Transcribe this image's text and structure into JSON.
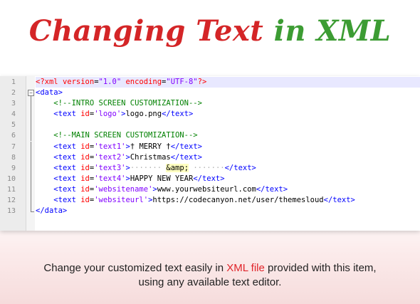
{
  "title": {
    "part1": "Changing Text",
    "part2": "in XML",
    "colors": {
      "part1": "#d42527",
      "part2": "#3c9c33"
    }
  },
  "editor": {
    "lines": [
      {
        "num": "1",
        "segments": [
          {
            "t": "<?xml ",
            "c": "pi"
          },
          {
            "t": "version",
            "c": "pi"
          },
          {
            "t": "=",
            "c": "txt"
          },
          {
            "t": "\"1.0\"",
            "c": "pival"
          },
          {
            "t": " encoding",
            "c": "pi"
          },
          {
            "t": "=",
            "c": "txt"
          },
          {
            "t": "\"UTF-8\"",
            "c": "pival"
          },
          {
            "t": "?>",
            "c": "pi"
          }
        ],
        "highlight": true
      },
      {
        "num": "2",
        "segments": [
          {
            "t": "<data>",
            "c": "tag"
          }
        ],
        "fold": "open"
      },
      {
        "num": "3",
        "segments": [
          {
            "t": "    ",
            "c": "txt"
          },
          {
            "t": "<!--INTRO SCREEN CUSTOMIZATION-->",
            "c": "comment"
          }
        ],
        "fold": "line"
      },
      {
        "num": "4",
        "segments": [
          {
            "t": "    ",
            "c": "txt"
          },
          {
            "t": "<text ",
            "c": "tag"
          },
          {
            "t": "id",
            "c": "attr"
          },
          {
            "t": "=",
            "c": "txt"
          },
          {
            "t": "'logo'",
            "c": "val"
          },
          {
            "t": ">",
            "c": "tag"
          },
          {
            "t": "logo.png",
            "c": "txt"
          },
          {
            "t": "</text>",
            "c": "tag"
          }
        ],
        "fold": "line"
      },
      {
        "num": "5",
        "segments": [],
        "fold": "line"
      },
      {
        "num": "6",
        "segments": [
          {
            "t": "    ",
            "c": "txt"
          },
          {
            "t": "<!--MAIN SCREEN CUSTOMIZATION-->",
            "c": "comment"
          }
        ],
        "fold": "line"
      },
      {
        "num": "7",
        "segments": [
          {
            "t": "    ",
            "c": "txt"
          },
          {
            "t": "<text ",
            "c": "tag"
          },
          {
            "t": "id",
            "c": "attr"
          },
          {
            "t": "=",
            "c": "txt"
          },
          {
            "t": "'text1'",
            "c": "val"
          },
          {
            "t": ">",
            "c": "tag"
          },
          {
            "t": "† MERRY †",
            "c": "txt"
          },
          {
            "t": "</text>",
            "c": "tag"
          }
        ],
        "fold": "line"
      },
      {
        "num": "8",
        "segments": [
          {
            "t": "    ",
            "c": "txt"
          },
          {
            "t": "<text ",
            "c": "tag"
          },
          {
            "t": "id",
            "c": "attr"
          },
          {
            "t": "=",
            "c": "txt"
          },
          {
            "t": "'text2'",
            "c": "val"
          },
          {
            "t": ">",
            "c": "tag"
          },
          {
            "t": "Christmas",
            "c": "txt"
          },
          {
            "t": "</text>",
            "c": "tag"
          }
        ],
        "fold": "line"
      },
      {
        "num": "9",
        "segments": [
          {
            "t": "    ",
            "c": "txt"
          },
          {
            "t": "<text ",
            "c": "tag"
          },
          {
            "t": "id",
            "c": "attr"
          },
          {
            "t": "=",
            "c": "txt"
          },
          {
            "t": "'text3'",
            "c": "val"
          },
          {
            "t": ">",
            "c": "tag"
          },
          {
            "t": "·······",
            "c": "dots"
          },
          {
            "t": " ",
            "c": "txt"
          },
          {
            "t": "&amp;",
            "c": "ent"
          },
          {
            "t": " ",
            "c": "txt"
          },
          {
            "t": "·······",
            "c": "dots"
          },
          {
            "t": "</text>",
            "c": "tag"
          }
        ],
        "fold": "line"
      },
      {
        "num": "10",
        "segments": [
          {
            "t": "    ",
            "c": "txt"
          },
          {
            "t": "<text ",
            "c": "tag"
          },
          {
            "t": "id",
            "c": "attr"
          },
          {
            "t": "=",
            "c": "txt"
          },
          {
            "t": "'text4'",
            "c": "val"
          },
          {
            "t": ">",
            "c": "tag"
          },
          {
            "t": "HAPPY NEW YEAR",
            "c": "txt"
          },
          {
            "t": "</text>",
            "c": "tag"
          }
        ],
        "fold": "line"
      },
      {
        "num": "11",
        "segments": [
          {
            "t": "    ",
            "c": "txt"
          },
          {
            "t": "<text ",
            "c": "tag"
          },
          {
            "t": "id",
            "c": "attr"
          },
          {
            "t": "=",
            "c": "txt"
          },
          {
            "t": "'websitename'",
            "c": "val"
          },
          {
            "t": ">",
            "c": "tag"
          },
          {
            "t": "www.yourwebsiteurl.com",
            "c": "txt"
          },
          {
            "t": "</text>",
            "c": "tag"
          }
        ],
        "fold": "line"
      },
      {
        "num": "12",
        "segments": [
          {
            "t": "    ",
            "c": "txt"
          },
          {
            "t": "<text ",
            "c": "tag"
          },
          {
            "t": "id",
            "c": "attr"
          },
          {
            "t": "=",
            "c": "txt"
          },
          {
            "t": "'websiteurl'",
            "c": "val"
          },
          {
            "t": ">",
            "c": "tag"
          },
          {
            "t": "https://codecanyon.net/user/themesloud",
            "c": "txt"
          },
          {
            "t": "</text>",
            "c": "tag"
          }
        ],
        "fold": "line"
      },
      {
        "num": "13",
        "segments": [
          {
            "t": "</data>",
            "c": "tag"
          }
        ],
        "fold": "end"
      }
    ]
  },
  "caption": {
    "line1_before": "Change your customized text easily in ",
    "line1_highlight": "XML file",
    "line1_after": " provided with this item,",
    "line2": "using any available text editor.",
    "highlight_color": "#e0242a"
  }
}
